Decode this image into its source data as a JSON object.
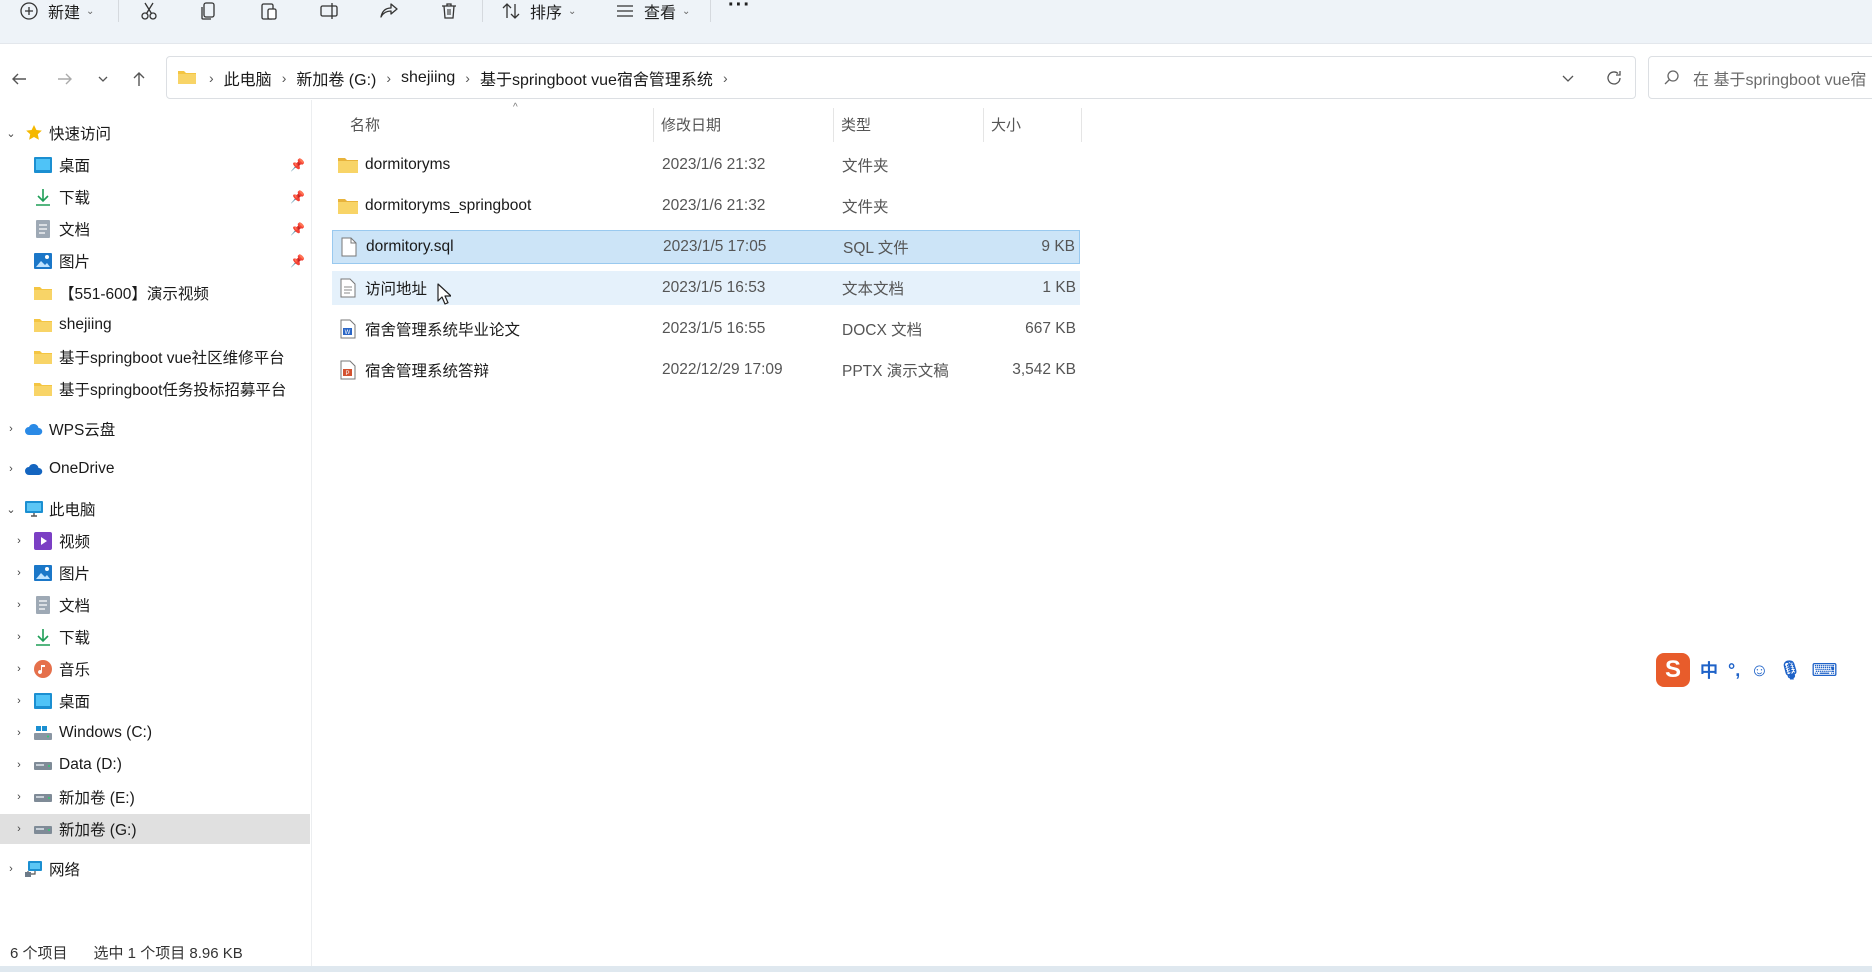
{
  "toolbar": {
    "new_label": "新建",
    "sort_label": "排序",
    "view_label": "查看",
    "more_label": "···"
  },
  "breadcrumb": {
    "items": [
      "此电脑",
      "新加卷 (G:)",
      "shejiing",
      "基于springboot vue宿舍管理系统"
    ]
  },
  "search": {
    "placeholder": "在 基于springboot vue宿"
  },
  "sidebar": {
    "quick_access": "快速访问",
    "pinned": [
      "桌面",
      "下载",
      "文档",
      "图片"
    ],
    "recent": [
      "【551-600】演示视频",
      "shejiing",
      "基于springboot vue社区维修平台",
      "基于springboot任务投标招募平台"
    ],
    "wps": "WPS云盘",
    "onedrive": "OneDrive",
    "this_pc": "此电脑",
    "pc_items": [
      "视频",
      "图片",
      "文档",
      "下载",
      "音乐",
      "桌面",
      "Windows (C:)",
      "Data (D:)",
      "新加卷 (E:)",
      "新加卷 (G:)"
    ],
    "network": "网络"
  },
  "columns": {
    "name": "名称",
    "date": "修改日期",
    "type": "类型",
    "size": "大小"
  },
  "files": [
    {
      "name": "dormitoryms",
      "date": "2023/1/6 21:32",
      "type": "文件夹",
      "size": ""
    },
    {
      "name": "dormitoryms_springboot",
      "date": "2023/1/6 21:32",
      "type": "文件夹",
      "size": ""
    },
    {
      "name": "dormitory.sql",
      "date": "2023/1/5 17:05",
      "type": "SQL 文件",
      "size": "9 KB"
    },
    {
      "name": "访问地址",
      "date": "2023/1/5 16:53",
      "type": "文本文档",
      "size": "1 KB"
    },
    {
      "name": "宿舍管理系统毕业论文",
      "date": "2023/1/5 16:55",
      "type": "DOCX 文档",
      "size": "667 KB"
    },
    {
      "name": "宿舍管理系统答辩",
      "date": "2022/12/29 17:09",
      "type": "PPTX 演示文稿",
      "size": "3,542 KB"
    }
  ],
  "status": {
    "count": "6 个项目",
    "selection": "选中 1 个项目  8.96 KB"
  },
  "ime": {
    "logo": "S",
    "mode": "中"
  },
  "colors": {
    "selected_row": "#cce4f7",
    "hover_row": "#e5f1fb",
    "folder": "#f4c542",
    "toolbar_bg": "#eef3f8"
  }
}
